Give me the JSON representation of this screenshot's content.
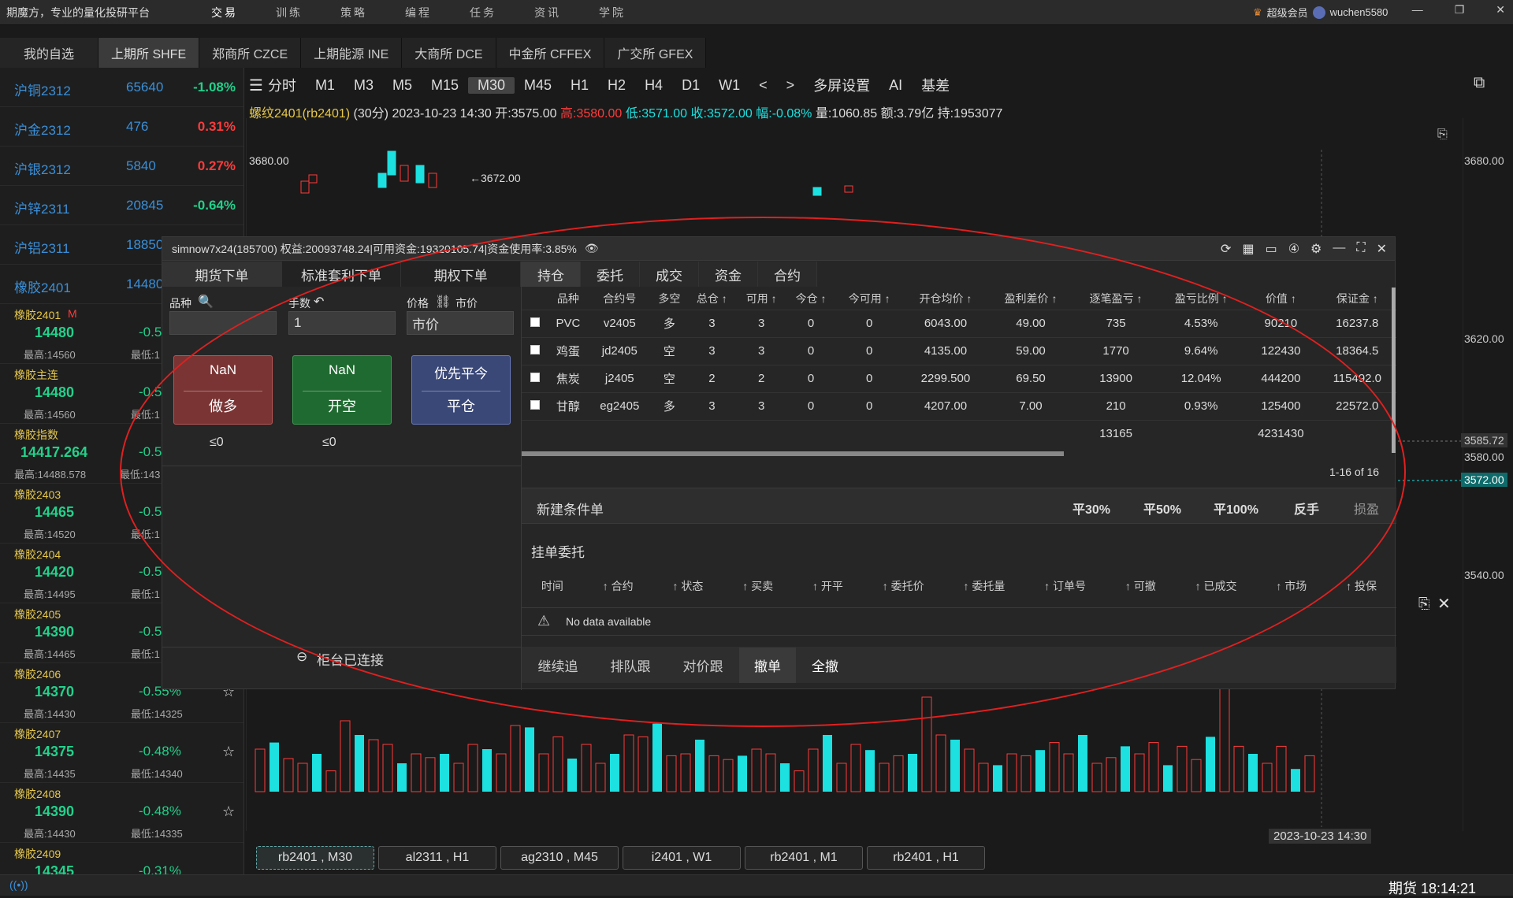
{
  "app": {
    "brand": "期魔方，专业的量化投研平台",
    "nav": [
      "交易",
      "训练",
      "策略",
      "编程",
      "任务",
      "资讯",
      "学院"
    ],
    "vip": "超级会员",
    "user": "wuchen5580"
  },
  "exchanges": [
    "我的自选",
    "上期所 SHFE",
    "郑商所 CZCE",
    "上期能源 INE",
    "大商所 DCE",
    "中金所 CFFEX",
    "广交所 GFEX"
  ],
  "watchlist": [
    {
      "name": "沪铜2312",
      "price": "65640",
      "change": "-1.08%",
      "dir": "down"
    },
    {
      "name": "沪金2312",
      "price": "476",
      "change": "0.31%",
      "dir": "up"
    },
    {
      "name": "沪银2312",
      "price": "5840",
      "change": "0.27%",
      "dir": "up"
    },
    {
      "name": "沪锌2311",
      "price": "20845",
      "change": "-0.64%",
      "dir": "down"
    },
    {
      "name": "沪铝2311",
      "price": "18850",
      "change": "",
      "dir": "down"
    },
    {
      "name": "橡胶2401",
      "price": "14480",
      "change": "",
      "dir": "down"
    }
  ],
  "cards": [
    {
      "name": "橡胶2401",
      "price": "14480",
      "change": "-0.5",
      "high": "最高:14560",
      "low": "最低:1"
    },
    {
      "name": "橡胶主连",
      "price": "14480",
      "change": "-0.5",
      "high": "最高:14560",
      "low": "最低:1"
    },
    {
      "name": "橡胶指数",
      "price": "14417.264",
      "change": "-0.5",
      "high": "最高:14488.578",
      "low": "最低:143"
    },
    {
      "name": "橡胶2403",
      "price": "14465",
      "change": "-0.5",
      "high": "最高:14520",
      "low": "最低:1"
    },
    {
      "name": "橡胶2404",
      "price": "14420",
      "change": "-0.5",
      "high": "最高:14495",
      "low": "最低:1"
    },
    {
      "name": "橡胶2405",
      "price": "14390",
      "change": "-0.5",
      "high": "最高:14465",
      "low": "最低:1"
    },
    {
      "name": "橡胶2406",
      "price": "14370",
      "change": "-0.55%",
      "high": "最高:14430",
      "low": "最低:14325"
    },
    {
      "name": "橡胶2407",
      "price": "14375",
      "change": "-0.48%",
      "high": "最高:14435",
      "low": "最低:14340"
    },
    {
      "name": "橡胶2408",
      "price": "14390",
      "change": "-0.48%",
      "high": "最高:14430",
      "low": "最低:14335"
    },
    {
      "name": "橡胶2409",
      "price": "14345",
      "change": "-0.31%",
      "high": "",
      "low": ""
    }
  ],
  "timeframes": [
    "分时",
    "M1",
    "M3",
    "M5",
    "M15",
    "M30",
    "M45",
    "H1",
    "H2",
    "H4",
    "D1",
    "W1",
    "<",
    ">",
    "多屏设置",
    "AI",
    "基差"
  ],
  "info": {
    "symbol": "螺纹2401(rb2401)",
    "period": "(30分)",
    "date": "2023-10-23",
    "time": "14:30",
    "open": "开:3575.00",
    "high": "高:3580.00",
    "low": "低:3571.00",
    "close": "收:3572.00",
    "amp": "幅:-0.08%",
    "vol": "量:1060.85",
    "amt": "额:3.79亿",
    "hold": "持:1953077"
  },
  "yaxis": {
    "v3680": "3680.00",
    "v3620": "3620.00",
    "v3585": "3585.72",
    "v3580": "3580.00",
    "v3572": "3572.00",
    "v3540": "3540.00"
  },
  "annot": {
    "peak": "←3672.00",
    "left3680": "3680.00",
    "timestamp": "2023-10-23  14:30"
  },
  "bottomtabs": [
    "rb2401 , M30",
    "al2311 , H1",
    "ag2310 , M45",
    "i2401 , W1",
    "rb2401 , M1",
    "rb2401 , H1"
  ],
  "status": {
    "clock": "期货 18:14:21"
  },
  "panel": {
    "title": "simnow7x24(185700) 权益:20093748.24|可用资金:19320105.74|资金使用率:3.85%",
    "lefttabs": [
      "期货下单",
      "标准套利下单",
      "期权下单"
    ],
    "labels": {
      "variety": "品种",
      "qty": "手数",
      "price": "价格",
      "market": "市价"
    },
    "qty_value": "1",
    "price_value": "市价",
    "btn_buy": {
      "top": "NaN",
      "bottom": "做多",
      "limit": "≤0"
    },
    "btn_sell": {
      "top": "NaN",
      "bottom": "开空",
      "limit": "≤0"
    },
    "btn_close": {
      "top": "优先平今",
      "bottom": "平仓"
    },
    "connected": "柜台已连接",
    "righttabs": [
      "持仓",
      "委托",
      "成交",
      "资金",
      "合约"
    ],
    "columns": [
      "品种",
      "合约号",
      "多空",
      "总仓 ↑",
      "可用 ↑",
      "今仓 ↑",
      "今可用 ↑",
      "开仓均价 ↑",
      "盈利差价 ↑",
      "逐笔盈亏 ↑",
      "盈亏比例 ↑",
      "价值 ↑",
      "保证金 ↑"
    ],
    "rows": [
      {
        "v": "PVC",
        "c": "v2405",
        "d": "多",
        "t": "3",
        "a": "3",
        "tc": "0",
        "ta": "0",
        "op": "6043.00",
        "pd": "49.00",
        "pl": "735",
        "pr": "4.53%",
        "val": "90210",
        "m": "16237.8"
      },
      {
        "v": "鸡蛋",
        "c": "jd2405",
        "d": "空",
        "t": "3",
        "a": "3",
        "tc": "0",
        "ta": "0",
        "op": "4135.00",
        "pd": "59.00",
        "pl": "1770",
        "pr": "9.64%",
        "val": "122430",
        "m": "18364.5"
      },
      {
        "v": "焦炭",
        "c": "j2405",
        "d": "空",
        "t": "2",
        "a": "2",
        "tc": "0",
        "ta": "0",
        "op": "2299.500",
        "pd": "69.50",
        "pl": "13900",
        "pr": "12.04%",
        "val": "444200",
        "m": "115492.0"
      },
      {
        "v": "甘醇",
        "c": "eg2405",
        "d": "多",
        "t": "3",
        "a": "3",
        "tc": "0",
        "ta": "0",
        "op": "4207.00",
        "pd": "7.00",
        "pl": "210",
        "pr": "0.93%",
        "val": "125400",
        "m": "22572.0"
      }
    ],
    "totals": {
      "pl": "13165",
      "val": "4231430"
    },
    "pagination": "1-16 of 16",
    "new_cond": "新建条件单",
    "quick": [
      "平30%",
      "平50%",
      "平100%",
      "反手",
      "损盈"
    ],
    "pending_title": "挂单委托",
    "pending_cols": [
      "时间",
      "↑ 合约",
      "↑ 状态",
      "↑ 买卖",
      "↑ 开平",
      "↑ 委托价",
      "↑ 委托量",
      "↑ 订单号",
      "↑ 可撤",
      "↑ 已成交",
      "↑ 市场",
      "↑ 投保"
    ],
    "nodata": "No data available",
    "actions": [
      "继续追",
      "排队跟",
      "对价跟",
      "撤单",
      "全撤"
    ]
  },
  "colors": {
    "up": "#ff3b3b",
    "down": "#22d18b",
    "accent": "#1de0e0"
  }
}
